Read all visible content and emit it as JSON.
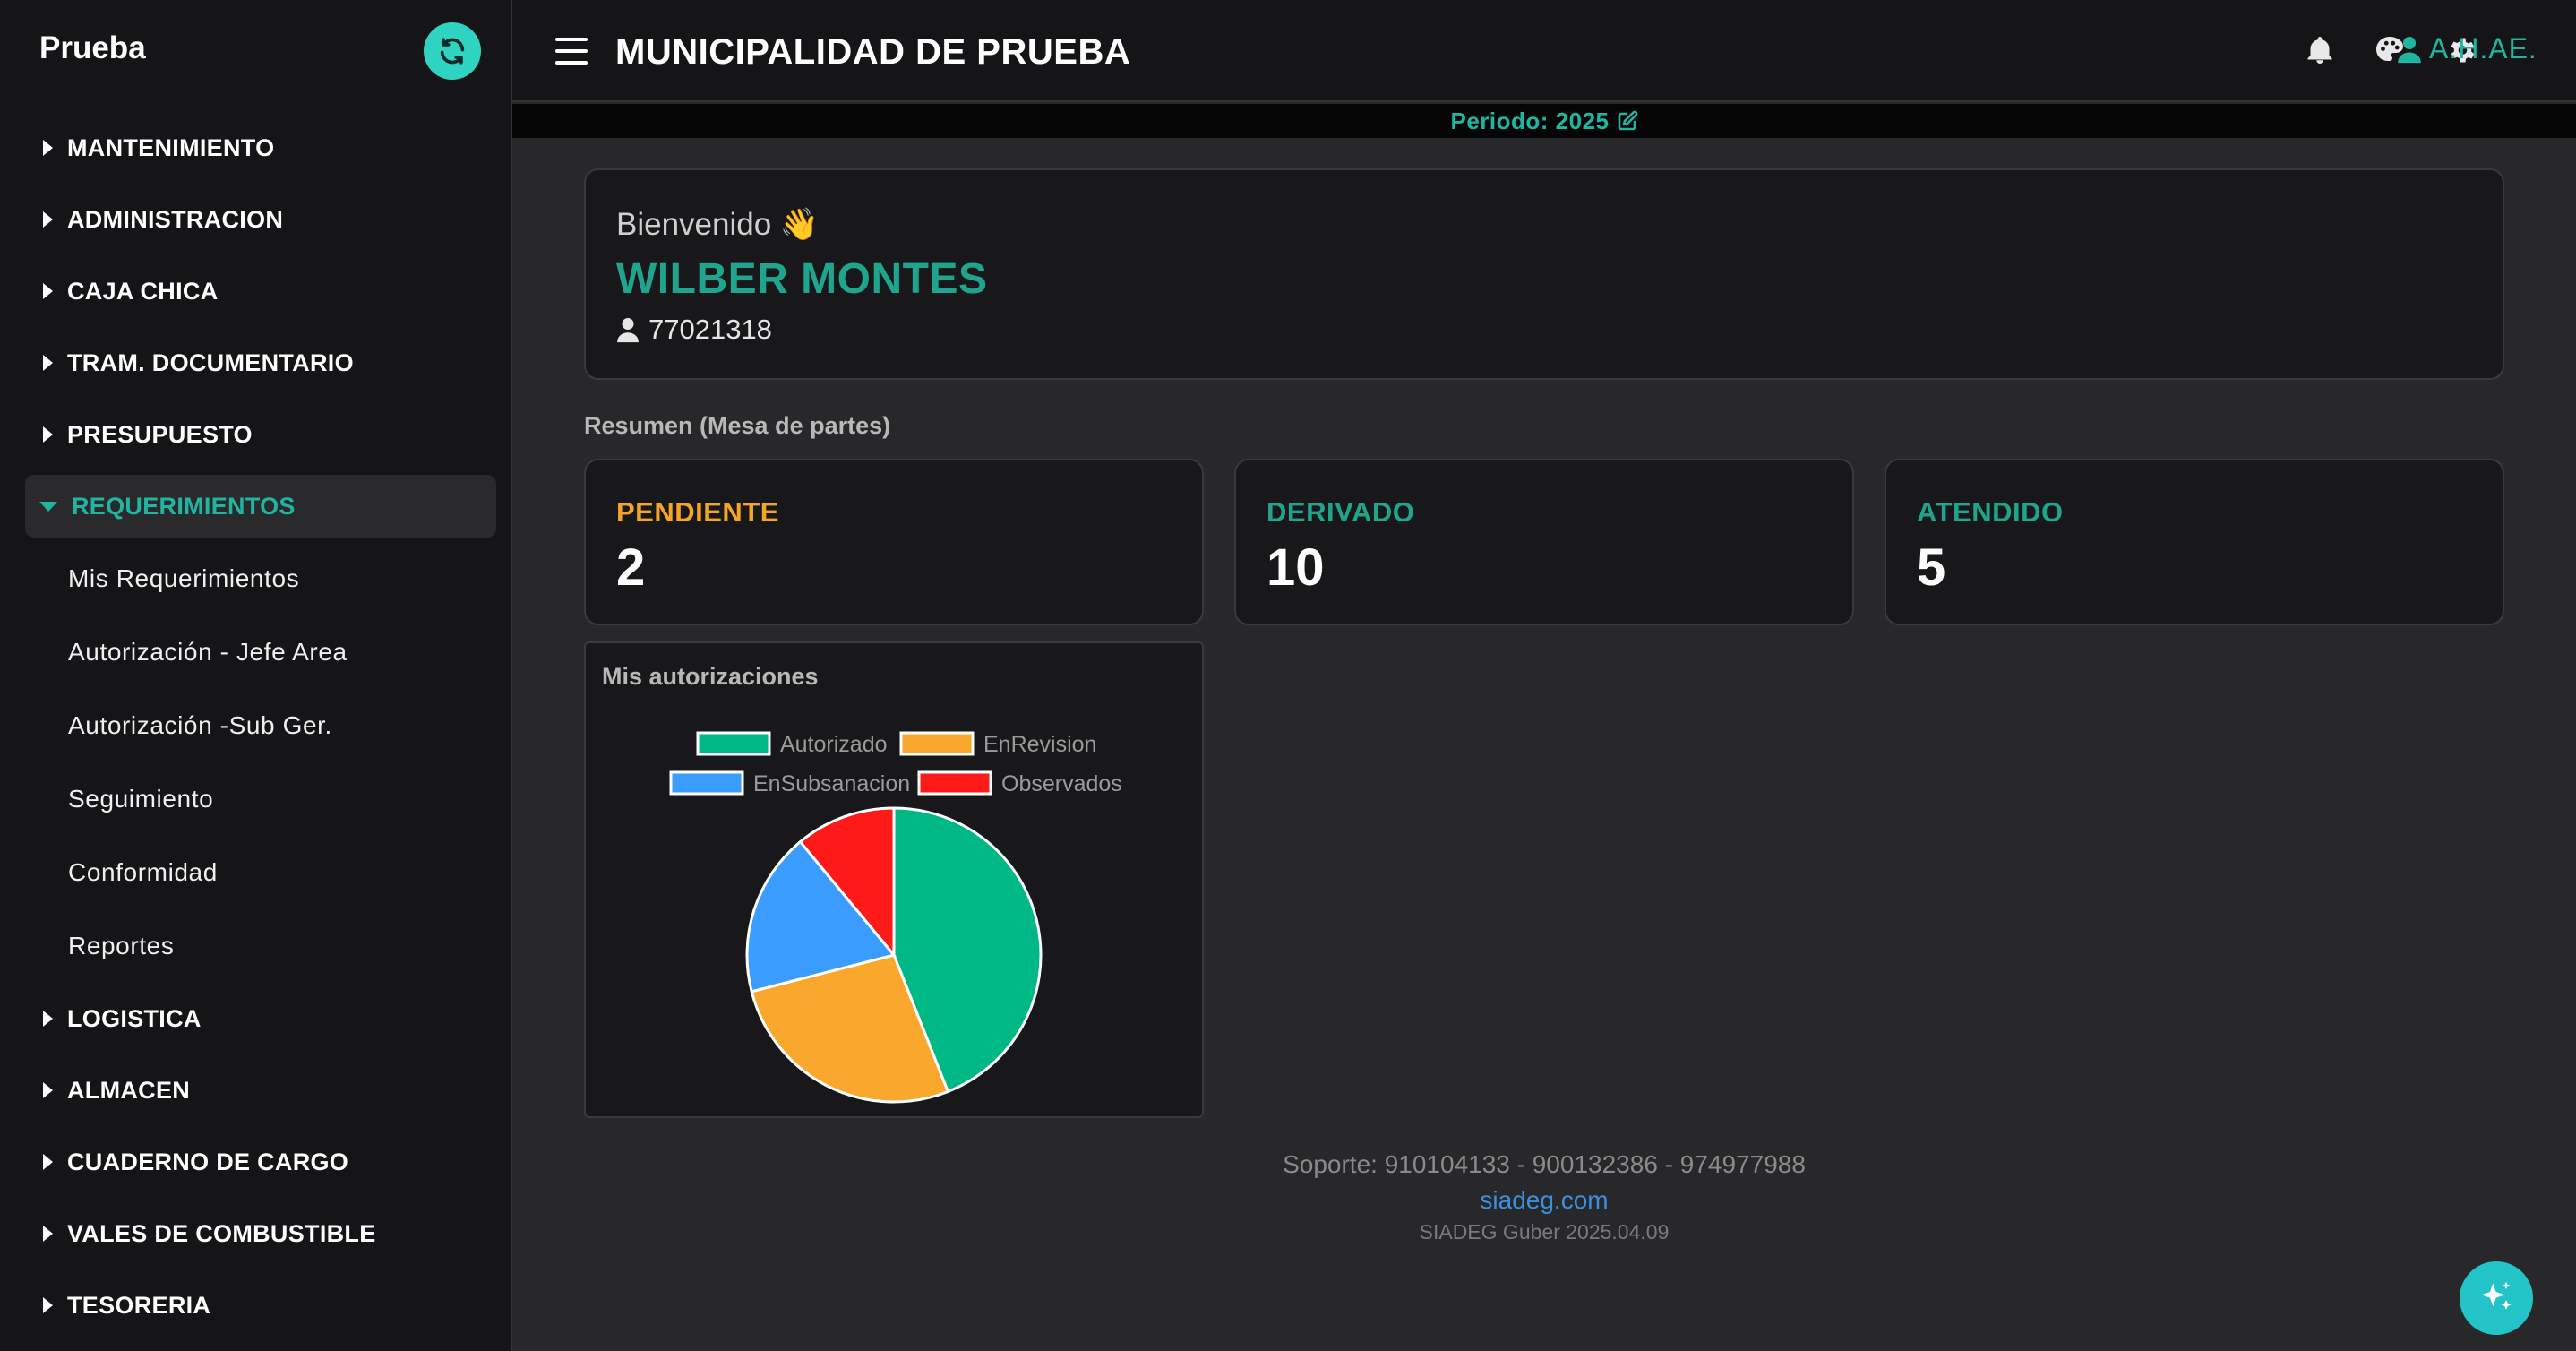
{
  "sidebar": {
    "brand": "Prueba",
    "menu_before": [
      {
        "label": "MANTENIMIENTO"
      },
      {
        "label": "ADMINISTRACION"
      },
      {
        "label": "CAJA CHICA"
      },
      {
        "label": "TRAM. DOCUMENTARIO"
      },
      {
        "label": "PRESUPUESTO"
      }
    ],
    "active": {
      "label": "REQUERIMIENTOS"
    },
    "sub_items": [
      {
        "label": "Mis Requerimientos"
      },
      {
        "label": "Autorización - Jefe Area"
      },
      {
        "label": "Autorización -Sub Ger."
      },
      {
        "label": "Seguimiento"
      },
      {
        "label": "Conformidad"
      },
      {
        "label": "Reportes"
      }
    ],
    "menu_after": [
      {
        "label": "LOGISTICA"
      },
      {
        "label": "ALMACEN"
      },
      {
        "label": "CUADERNO DE CARGO"
      },
      {
        "label": "VALES DE COMBUSTIBLE"
      },
      {
        "label": "TESORERIA"
      }
    ]
  },
  "header": {
    "title": "MUNICIPALIDAD DE PRUEBA",
    "user": "A.H.AE.",
    "icons": [
      "bell-icon",
      "palette-icon",
      "gear-icon",
      "user-icon"
    ]
  },
  "period": {
    "label": "Periodo: 2025"
  },
  "welcome": {
    "greeting": "Bienvenido 👋",
    "name": "WILBER MONTES",
    "dni": "77021318"
  },
  "summary": {
    "title": "Resumen (Mesa de partes)",
    "stats": [
      {
        "label": "PENDIENTE",
        "value": "2",
        "color": "#f5a524"
      },
      {
        "label": "DERIVADO",
        "value": "10",
        "color": "#1fa58e"
      },
      {
        "label": "ATENDIDO",
        "value": "5",
        "color": "#1fa58e"
      }
    ]
  },
  "chart_data": {
    "type": "pie",
    "title": "Mis autorizaciones",
    "categories": [
      "Autorizado",
      "EnRevision",
      "EnSubsanacion",
      "Observados"
    ],
    "values": [
      44,
      27,
      18,
      11
    ],
    "colors": [
      "#00b886",
      "#f9a82d",
      "#3a9cff",
      "#ff1a1a"
    ],
    "legend": "top"
  },
  "footer": {
    "support": "Soporte: 910104133 - 900132386 - 974977988",
    "link": "siadeg.com",
    "version": "SIADEG Guber 2025.04.09"
  }
}
